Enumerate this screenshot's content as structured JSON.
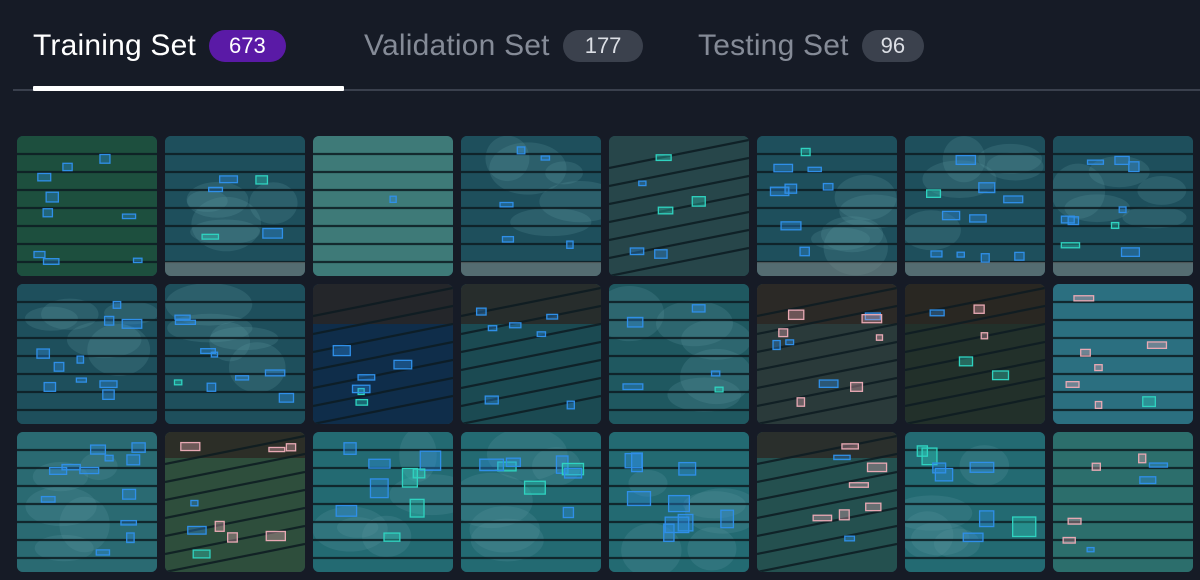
{
  "tabs": [
    {
      "label": "Training Set",
      "count": "673",
      "active": true
    },
    {
      "label": "Validation Set",
      "count": "177",
      "active": false
    },
    {
      "label": "Testing Set",
      "count": "96",
      "active": false
    }
  ],
  "colors": {
    "background": "#161b26",
    "active_badge": "#5a1aa6",
    "inactive_badge": "#3b414d",
    "box_blue": "#2f8fe8",
    "box_teal": "#2fd3c0",
    "box_pink": "#e8a9b4"
  },
  "gallery": {
    "images": [
      {
        "scene": "green-pool",
        "theme": "#1d4f3e",
        "boxes": 9
      },
      {
        "scene": "overhead-lanes",
        "theme": "#1e4f5c",
        "boxes": 5
      },
      {
        "scene": "light-pool",
        "theme": "#3e7a78",
        "boxes": 1
      },
      {
        "scene": "overhead-lanes",
        "theme": "#1e4f5c",
        "boxes": 5
      },
      {
        "scene": "angled-pool",
        "theme": "#27464a",
        "boxes": 6
      },
      {
        "scene": "overhead-lanes",
        "theme": "#1e4f5c",
        "boxes": 8
      },
      {
        "scene": "overhead-lanes",
        "theme": "#1e4f5c",
        "boxes": 10
      },
      {
        "scene": "overhead-lanes",
        "theme": "#1e4f5c",
        "boxes": 9
      },
      {
        "scene": "overhead-lanes",
        "theme": "#1e4f5c",
        "boxes": 10
      },
      {
        "scene": "overhead-lanes",
        "theme": "#1e4f5c",
        "boxes": 9
      },
      {
        "scene": "night-pool",
        "theme": "#0f2d4a",
        "boxes": 6
      },
      {
        "scene": "crowd-pool",
        "theme": "#1b4a52",
        "boxes": 7
      },
      {
        "scene": "overhead-lanes",
        "theme": "#1f5860",
        "boxes": 5
      },
      {
        "scene": "dark-arena",
        "theme": "#2a3a3a",
        "boxes": 10
      },
      {
        "scene": "dark-arena",
        "theme": "#22302a",
        "boxes": 5
      },
      {
        "scene": "bright-pool",
        "theme": "#2b6f80",
        "boxes": 7
      },
      {
        "scene": "speckled-pool",
        "theme": "#2a6a72",
        "boxes": 12
      },
      {
        "scene": "stands-lanes",
        "theme": "#2e4e3c",
        "boxes": 9
      },
      {
        "scene": "pool-divers",
        "theme": "#236a72",
        "boxes": 9
      },
      {
        "scene": "pool-divers",
        "theme": "#236a72",
        "boxes": 8
      },
      {
        "scene": "pool-divers",
        "theme": "#236a72",
        "boxes": 9
      },
      {
        "scene": "stands-lanes",
        "theme": "#24504f",
        "boxes": 8
      },
      {
        "scene": "pool-divers",
        "theme": "#236a72",
        "boxes": 8
      },
      {
        "scene": "bright-pool",
        "theme": "#2c6e6c",
        "boxes": 7
      }
    ]
  }
}
